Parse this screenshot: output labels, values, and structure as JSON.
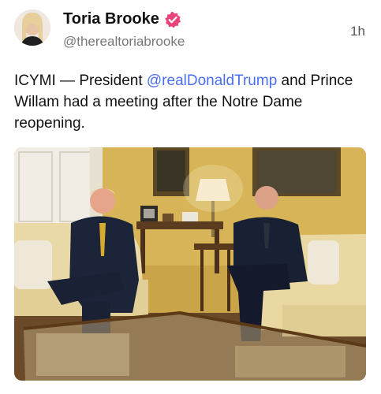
{
  "post": {
    "author_name": "Toria Brooke",
    "handle": "@therealtoriabrooke",
    "time": "1h",
    "text_before": "ICYMI — President ",
    "mention": "@realDonaldTrump",
    "text_after": " and Prince Willam had a meeting after the Notre Dame reopening.",
    "verified_icon": "verified-badge-icon",
    "verified_color": "#e8437a",
    "mention_color": "#4a6ef0"
  },
  "photo": {
    "icon": "photo-image"
  }
}
